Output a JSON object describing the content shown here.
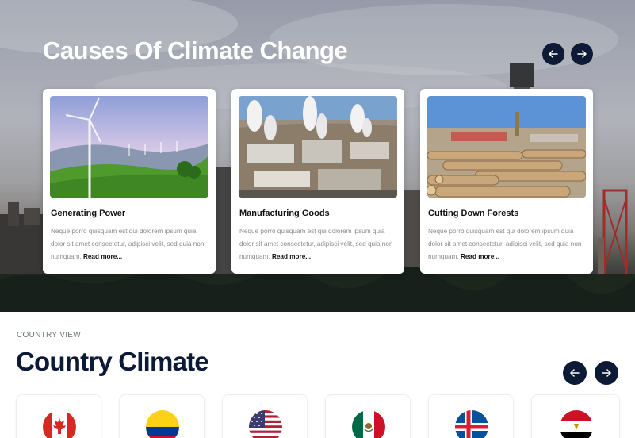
{
  "hero": {
    "title": "Causes Of Climate Change",
    "prev_label": "previous",
    "next_label": "next"
  },
  "cards": [
    {
      "title": "Generating Power",
      "text": "Neque porro quisquam est qui dolorem ipsum quia dolor sit amet consectetur, adipisci velit, sed quia non numquam.",
      "more": "Read more...",
      "image": "wind-turbines-photo"
    },
    {
      "title": "Manufacturing Goods",
      "text": "Neque porro quisquam est qui dolorem ipsum quia dolor sit amet consectetur, adipisci velit, sed quia non numquam.",
      "more": "Read more...",
      "image": "industrial-plant-photo"
    },
    {
      "title": "Cutting Down Forests",
      "text": "Neque porro quisquam est qui dolorem ipsum quia dolor sit amet consectetur, adipisci velit, sed quia non numquam.",
      "more": "Read more...",
      "image": "timber-logs-photo"
    }
  ],
  "countries_section": {
    "eyebrow": "COUNTRY VIEW",
    "title": "Country Climate",
    "flags": [
      "canada-flag-icon",
      "colombia-flag-icon",
      "usa-flag-icon",
      "mexico-flag-icon",
      "iceland-flag-icon",
      "egypt-flag-icon"
    ]
  },
  "colors": {
    "navy": "#0c1a36",
    "text_gray": "#8a8a8a"
  }
}
